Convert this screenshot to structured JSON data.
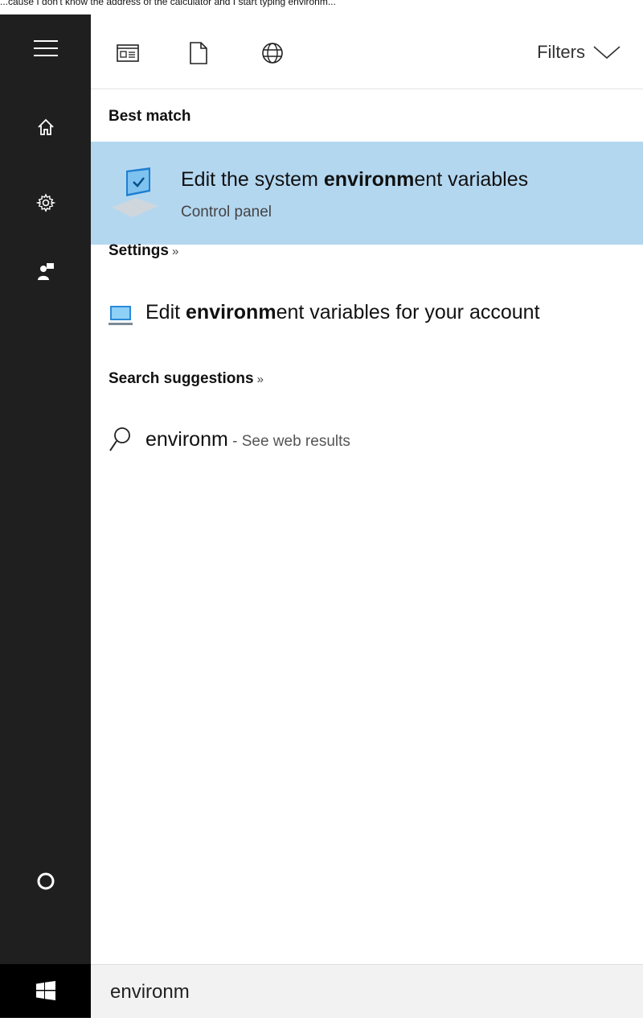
{
  "top_strip": {
    "text": "...cause I don't know the address of the calculator and I start typing environm..."
  },
  "toolbar": {
    "filters_label": "Filters"
  },
  "best_match": {
    "header": "Best match",
    "title_pre": "Edit the system ",
    "title_bold": "environm",
    "title_post": "ent variables",
    "subtitle": "Control panel"
  },
  "settings": {
    "header": "Settings",
    "chevron": "»",
    "item_pre": "Edit ",
    "item_bold": "environm",
    "item_post": "ent variables for your account"
  },
  "suggestions": {
    "header": "Search suggestions",
    "chevron": "»",
    "query": "environm",
    "web_suffix": " - See web results"
  },
  "search": {
    "value": "environm"
  }
}
